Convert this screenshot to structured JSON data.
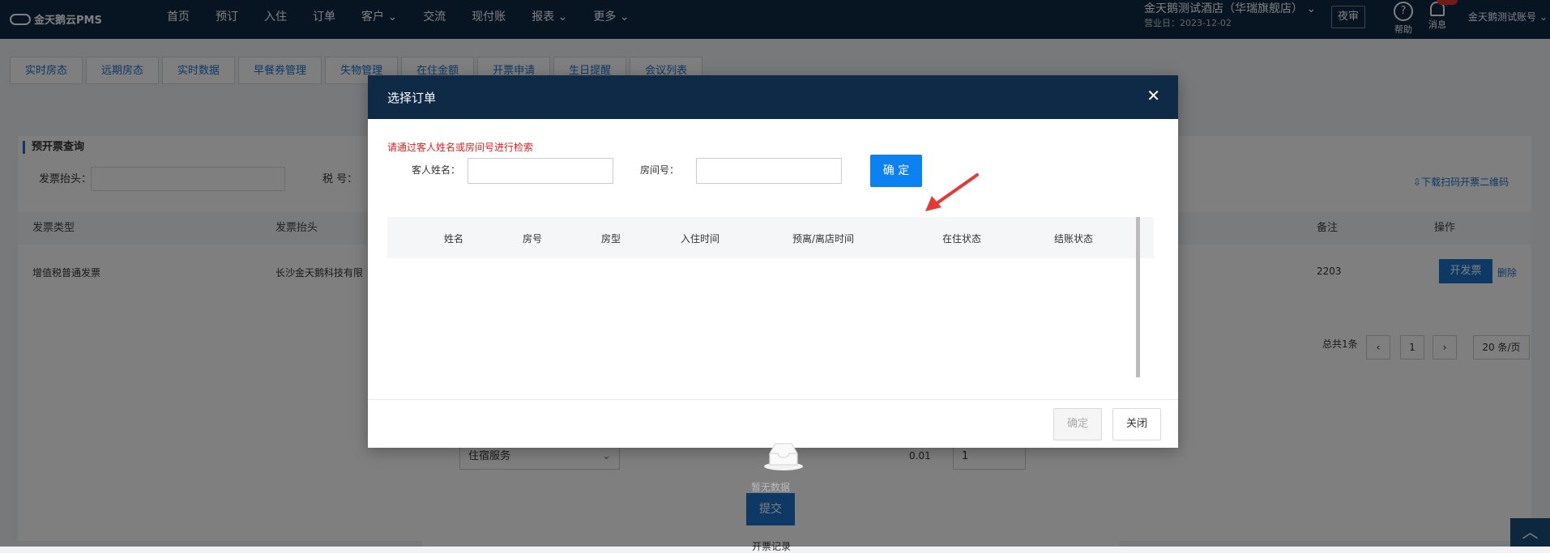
{
  "topbar": {
    "logo": "金天鹅云PMS",
    "nav": [
      "首页",
      "预订",
      "入住",
      "订单",
      "客户",
      "交流",
      "现付账",
      "报表",
      "更多"
    ],
    "hotel_name": "金天鹅测试酒店（华瑞旗舰店）",
    "business_date": "营业日：2023-12-02",
    "night_audit": "夜审",
    "help": "帮助",
    "messages": "消息",
    "account": "金天鹅测试账号"
  },
  "tabs": [
    "实时房态",
    "远期房态",
    "实时数据",
    "早餐券管理",
    "失物管理",
    "在住金额",
    "开票申请",
    "生日提醒",
    "会议列表"
  ],
  "background": {
    "section_title": "预开票查询",
    "label_invoice_title": "发票抬头：",
    "label_tax": "税 号：",
    "download": "下载扫码开票二维码",
    "columns": [
      "发票类型",
      "发票抬头",
      "备注",
      "操作"
    ],
    "row": {
      "type": "增值税普通发票",
      "title": "长沙金天鹅科技有限",
      "remark": "2203",
      "btn": "开发票",
      "delete": "删除"
    },
    "pager": {
      "total": "总共1条",
      "page": "1",
      "per_page": "20 条/页"
    },
    "service_select": "住宿服务",
    "amount": "0.01",
    "qty": "1",
    "submit": "提交",
    "record": "开票记录"
  },
  "modal": {
    "title": "选择订单",
    "hint": "请通过客人姓名或房间号进行检索",
    "guest_label": "客人姓名：",
    "guest_value": "",
    "room_label": "房间号：",
    "room_value": "",
    "search_btn": "确 定",
    "columns": [
      "姓名",
      "房号",
      "房型",
      "入住时间",
      "预离/离店时间",
      "在住状态",
      "结账状态"
    ],
    "empty_text": "暂无数据",
    "confirm_btn": "确定",
    "close_btn": "关闭"
  },
  "colors": {
    "header": "#0e2a47",
    "primary": "#0c82f2",
    "hint": "#e02020",
    "arrow": "#e53935"
  }
}
